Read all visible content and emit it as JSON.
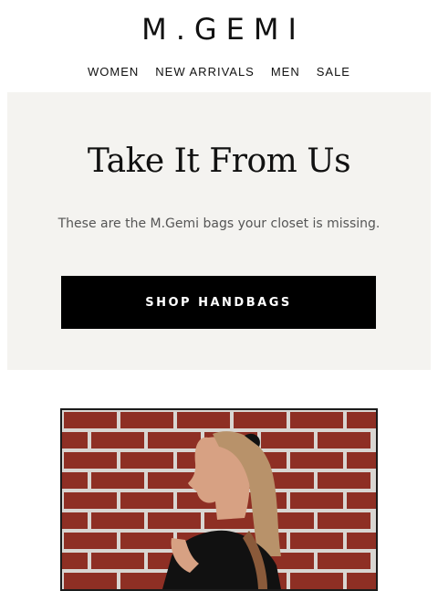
{
  "brand": {
    "logo_text": "M.GEMI"
  },
  "nav": {
    "items": [
      "WOMEN",
      "NEW ARRIVALS",
      "MEN",
      "SALE"
    ]
  },
  "hero": {
    "headline": "Take It From Us",
    "subtext": "These are the M.Gemi bags your closet is missing.",
    "cta_label": "SHOP HANDBAGS",
    "background_color": "#f4f3f0",
    "cta_color": "#000000"
  },
  "photo": {
    "description_icon": "brick-wall-portrait-photo"
  }
}
